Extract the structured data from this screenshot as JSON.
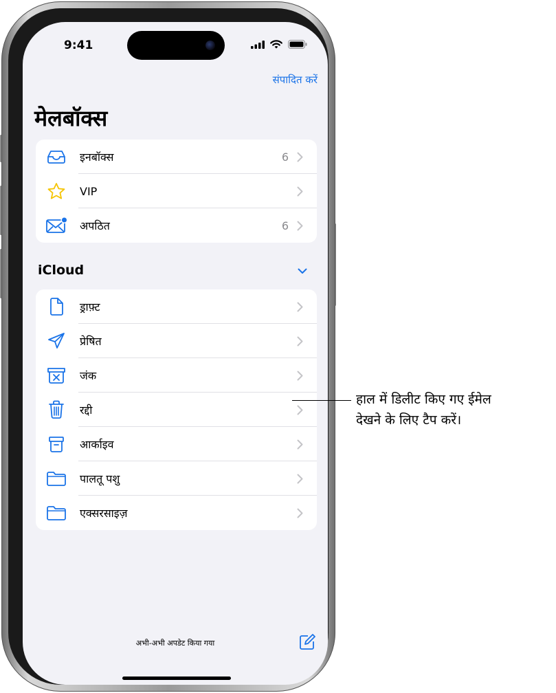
{
  "status_bar": {
    "time": "9:41"
  },
  "header": {
    "edit_label": "संपादित करें",
    "title": "मेलबॉक्स"
  },
  "mailboxes": [
    {
      "label": "इनबॉक्स",
      "count": "6",
      "icon": "inbox-icon"
    },
    {
      "label": "VIP",
      "count": "",
      "icon": "star-icon"
    },
    {
      "label": "अपठित",
      "count": "6",
      "icon": "unread-envelope-icon"
    }
  ],
  "icloud": {
    "title": "iCloud",
    "items": [
      {
        "label": "ड्राफ़्ट",
        "icon": "draft-document-icon"
      },
      {
        "label": "प्रेषित",
        "icon": "sent-paperplane-icon"
      },
      {
        "label": "जंक",
        "icon": "junk-box-icon"
      },
      {
        "label": "रद्दी",
        "icon": "trash-icon"
      },
      {
        "label": "आर्काइव",
        "icon": "archive-box-icon"
      },
      {
        "label": "पालतू पशु",
        "icon": "folder-icon"
      },
      {
        "label": "एक्सरसाइज़",
        "icon": "folder-icon"
      }
    ]
  },
  "footer": {
    "updated_text": "अभी-अभी अपडेट किया गया"
  },
  "callout": {
    "line1": "हाल में डिलीट किए गए ईमेल",
    "line2": "देखने के लिए टैप करें।"
  },
  "colors": {
    "accent": "#1a73e8",
    "background": "#f2f2f7",
    "star": "#f5c400"
  }
}
